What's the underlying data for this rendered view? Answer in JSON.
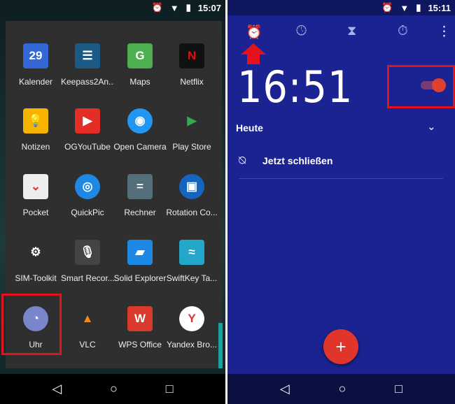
{
  "left": {
    "status_time": "15:07",
    "apps": [
      {
        "label": "Kalender",
        "icon": "calendar-icon",
        "color": "#3367d6",
        "glyph": "29"
      },
      {
        "label": "Keepass2An...",
        "icon": "keepass-icon",
        "color": "#1c5a86",
        "glyph": "☰"
      },
      {
        "label": "Maps",
        "icon": "maps-icon",
        "color": "#4caf50",
        "glyph": "G"
      },
      {
        "label": "Netflix",
        "icon": "netflix-icon",
        "color": "#111",
        "glyph": "N"
      },
      {
        "label": "Notizen",
        "icon": "keep-notes-icon",
        "color": "#f6b400",
        "glyph": "💡"
      },
      {
        "label": "OGYouTube",
        "icon": "youtube-icon",
        "color": "#e52d27",
        "glyph": "▶"
      },
      {
        "label": "Open Camera",
        "icon": "camera-icon",
        "color": "#2196f3",
        "glyph": "◉"
      },
      {
        "label": "Play Store",
        "icon": "play-store-icon",
        "color": "#2f2f2f",
        "glyph": "▶"
      },
      {
        "label": "Pocket",
        "icon": "pocket-icon",
        "color": "#eee",
        "glyph": "⌄"
      },
      {
        "label": "QuickPic",
        "icon": "quickpic-icon",
        "color": "#1e88e5",
        "glyph": "◎"
      },
      {
        "label": "Rechner",
        "icon": "calculator-icon",
        "color": "#546e7a",
        "glyph": "="
      },
      {
        "label": "Rotation Co...",
        "icon": "rotation-control-icon",
        "color": "#1565c0",
        "glyph": "▣"
      },
      {
        "label": "SIM-Toolkit",
        "icon": "sim-toolkit-icon",
        "color": "#2f2f2f",
        "glyph": "⚙"
      },
      {
        "label": "Smart Recor...",
        "icon": "microphone-icon",
        "color": "#444",
        "glyph": "🎙"
      },
      {
        "label": "Solid Explorer",
        "icon": "folder-icon",
        "color": "#1e88e5",
        "glyph": "▰"
      },
      {
        "label": "SwiftKey Ta...",
        "icon": "swiftkey-icon",
        "color": "#23a7c9",
        "glyph": "≈"
      },
      {
        "label": "Uhr",
        "icon": "clock-app-icon",
        "color": "#7986cb",
        "glyph": "◔"
      },
      {
        "label": "VLC",
        "icon": "vlc-icon",
        "color": "#2f2f2f",
        "glyph": "▲"
      },
      {
        "label": "WPS Office",
        "icon": "wps-office-icon",
        "color": "#d93a2b",
        "glyph": "W"
      },
      {
        "label": "Yandex Bro...",
        "icon": "yandex-browser-icon",
        "color": "#fff",
        "glyph": "Y"
      }
    ]
  },
  "right": {
    "status_time": "15:11",
    "tabs": [
      "alarm-icon",
      "clock-icon",
      "timer-icon",
      "stopwatch-icon"
    ],
    "alarm": {
      "time": "16:51",
      "enabled": true,
      "day": "Heute",
      "dismiss": "Jetzt schließen"
    },
    "fab": "+"
  },
  "nav": {
    "back": "◁",
    "home": "○",
    "recents": "□"
  },
  "colors": {
    "highlight": "#e4121c",
    "accent": "#e0352b"
  }
}
